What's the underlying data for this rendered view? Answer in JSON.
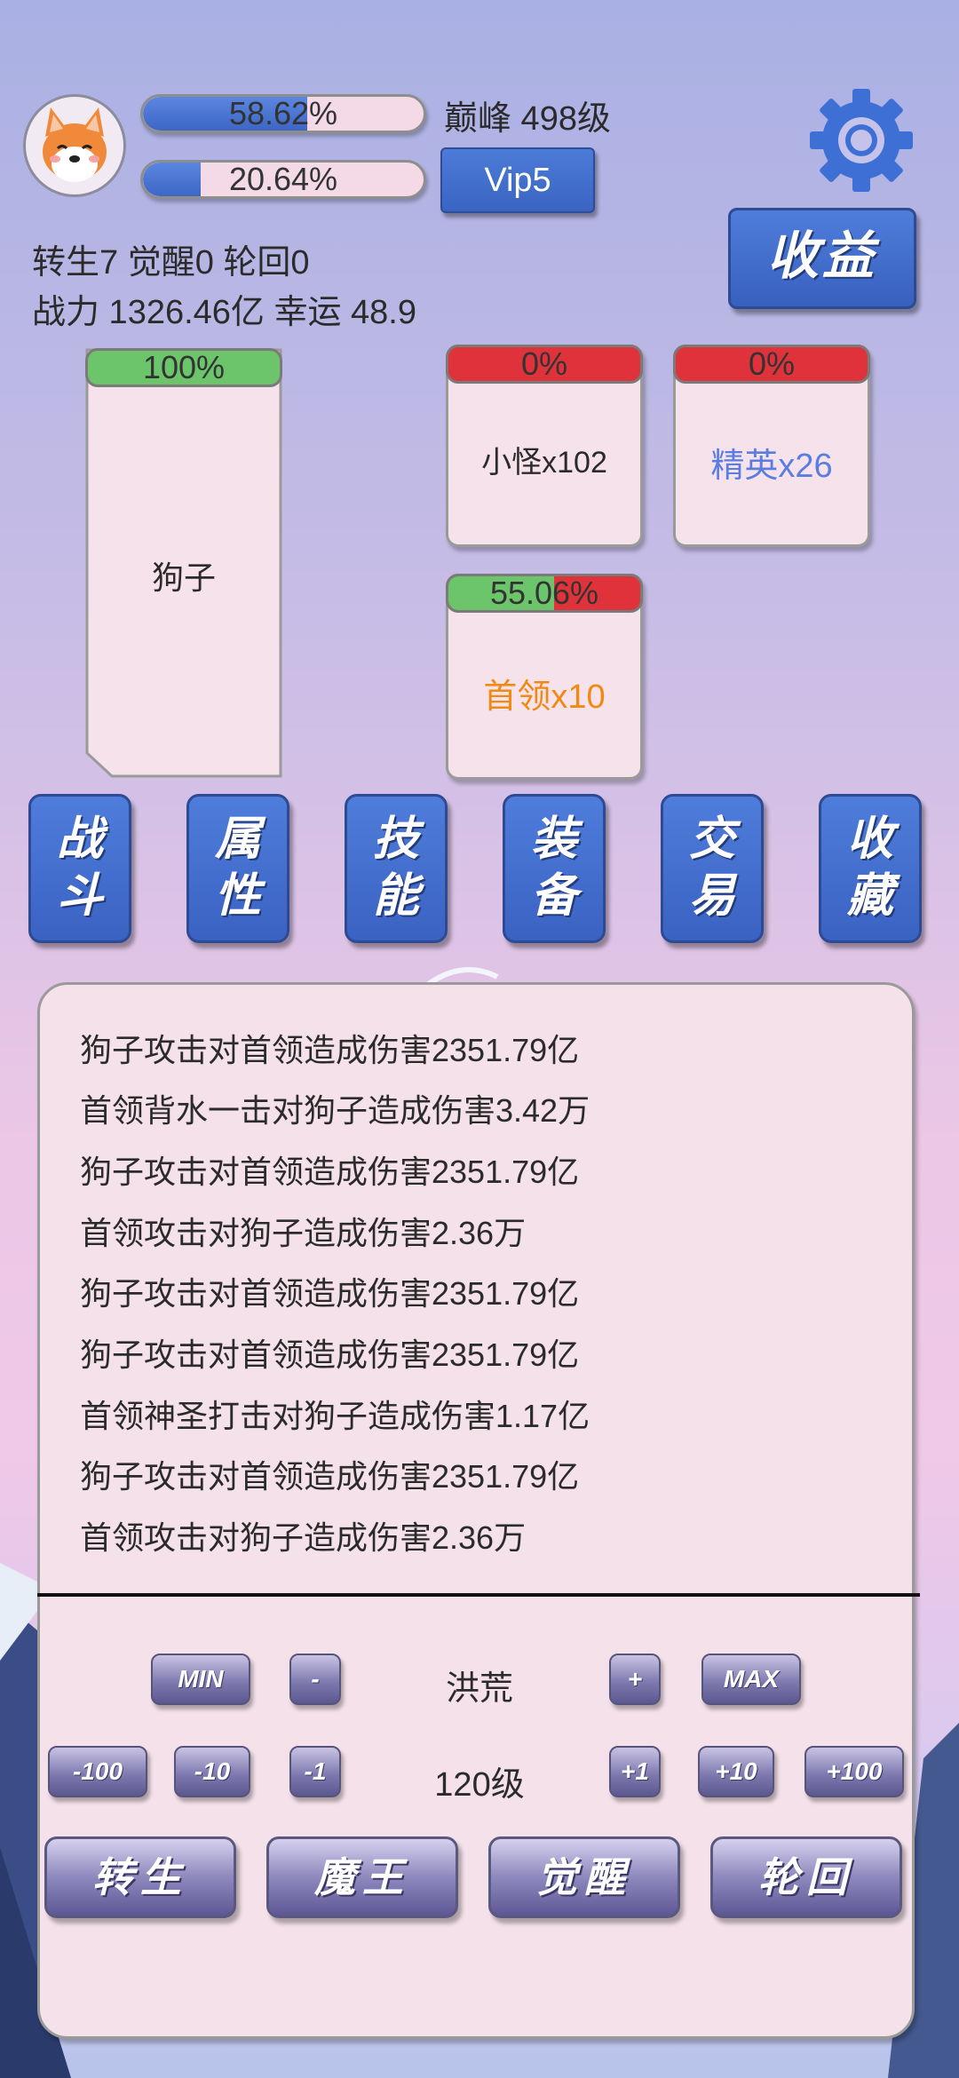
{
  "header": {
    "exp_percent": "58.62%",
    "exp_fill": 0.5862,
    "second_percent": "20.64%",
    "second_fill": 0.2064,
    "realm_level": "巅峰 498级",
    "vip": "Vip5",
    "income_button": "收益",
    "stats_line1": "转生7 觉醒0 轮回0",
    "stats_line2": "战力 1326.46亿  幸运 48.9"
  },
  "player": {
    "hp_percent": "100%",
    "hp_fill": 1.0,
    "name": "狗子"
  },
  "enemies": {
    "minion": {
      "hp_percent": "0%",
      "label": "小怪x102"
    },
    "elite": {
      "hp_percent": "0%",
      "label": "精英x26"
    },
    "boss": {
      "hp_percent": "55.06%",
      "hp_fill": 0.5506,
      "label": "首领x10"
    }
  },
  "colors": {
    "accent_blue": "#3d66c5",
    "hp_green": "#6cc56a",
    "hp_red": "#e0323a",
    "elite_blue": "#5a7de0",
    "boss_orange": "#f08a12"
  },
  "nav": [
    {
      "top": "战",
      "bottom": "斗"
    },
    {
      "top": "属",
      "bottom": "性"
    },
    {
      "top": "技",
      "bottom": "能"
    },
    {
      "top": "装",
      "bottom": "备"
    },
    {
      "top": "交",
      "bottom": "易"
    },
    {
      "top": "收",
      "bottom": "藏"
    }
  ],
  "battle_log": [
    "狗子攻击对首领造成伤害2351.79亿",
    "首领背水一击对狗子造成伤害3.42万",
    "狗子攻击对首领造成伤害2351.79亿",
    "首领攻击对狗子造成伤害2.36万",
    "狗子攻击对首领造成伤害2351.79亿",
    "狗子攻击对首领造成伤害2351.79亿",
    "首领神圣打击对狗子造成伤害1.17亿",
    "狗子攻击对首领造成伤害2351.79亿",
    "首领攻击对狗子造成伤害2.36万"
  ],
  "controls": {
    "difficulty": {
      "min": "MIN",
      "minus": "-",
      "value": "洪荒",
      "plus": "+",
      "max": "MAX"
    },
    "level": {
      "m100": "-100",
      "m10": "-10",
      "m1": "-1",
      "value": "120级",
      "p1": "+1",
      "p10": "+10",
      "p100": "+100"
    },
    "actions": [
      "转生",
      "魔王",
      "觉醒",
      "轮回"
    ]
  }
}
